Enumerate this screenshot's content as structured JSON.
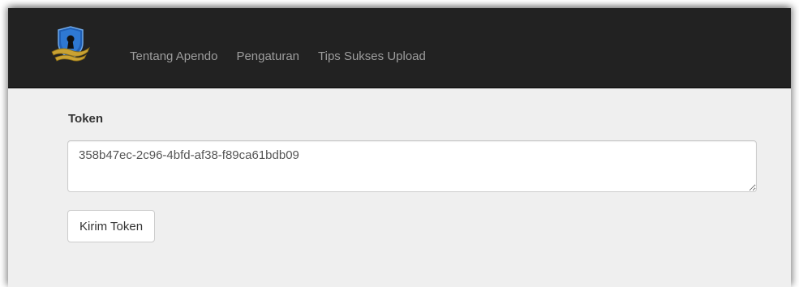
{
  "navbar": {
    "logo_icon": "shield-keyhole-icon",
    "links": [
      {
        "label": "Tentang Apendo"
      },
      {
        "label": "Pengaturan"
      },
      {
        "label": "Tips Sukses Upload"
      }
    ]
  },
  "form": {
    "token_label": "Token",
    "token_value": "358b47ec-2c96-4bfd-af38-f89ca61bdb09",
    "submit_label": "Kirim Token"
  },
  "colors": {
    "navbar_bg": "#222222",
    "page_bg": "#efefef",
    "nav_link": "#9d9d9d",
    "logo_blue": "#1f5fb5",
    "logo_gold": "#c9a233"
  }
}
